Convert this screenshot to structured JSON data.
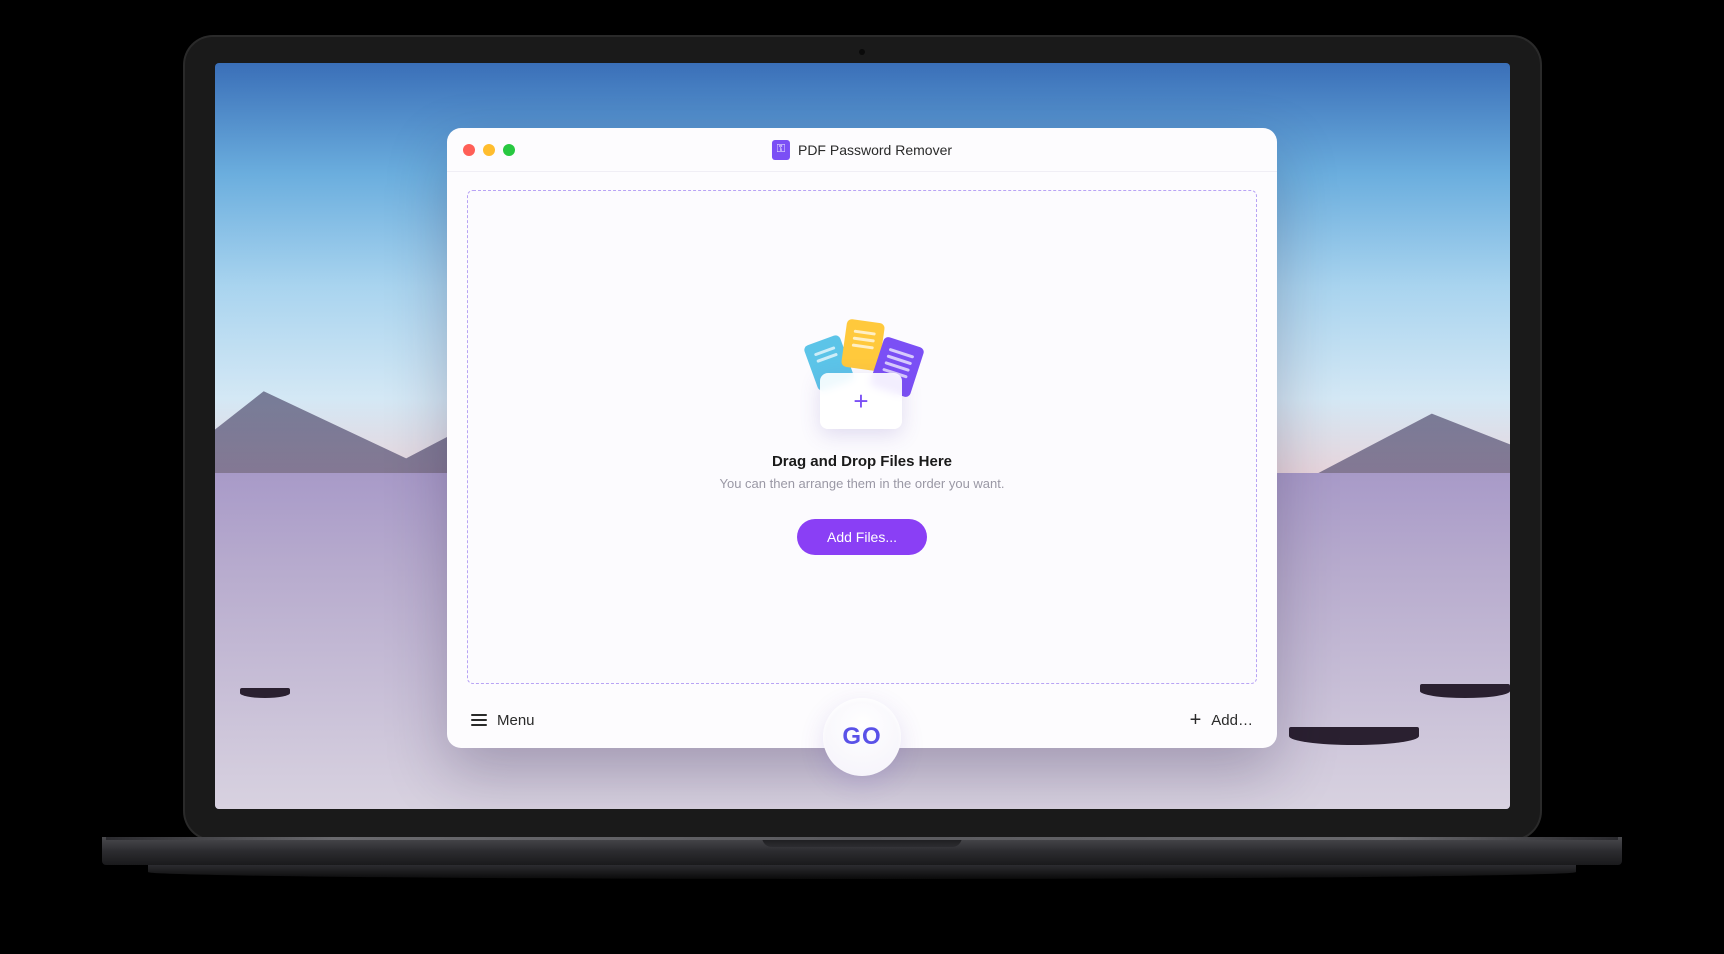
{
  "app": {
    "title": "PDF Password Remover"
  },
  "dropzone": {
    "title": "Drag and Drop Files Here",
    "subtitle": "You can then arrange them in the order you want.",
    "add_button": "Add Files..."
  },
  "bottombar": {
    "menu_label": "Menu",
    "go_label": "GO",
    "add_label": "Add…"
  },
  "colors": {
    "accent": "#8a3ff5",
    "go_text": "#5a52e8",
    "dashed_border": "#b8a3f5"
  }
}
